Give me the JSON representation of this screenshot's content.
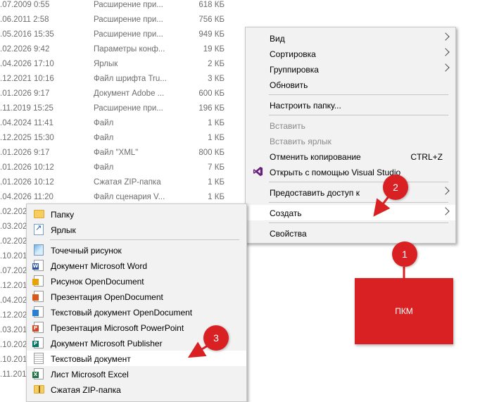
{
  "file_list": [
    {
      "date": ".07.2009 0:55",
      "type": "Расширение при...",
      "size": "618 КБ"
    },
    {
      "date": ".06.2011 2:58",
      "type": "Расширение при...",
      "size": "756 КБ"
    },
    {
      "date": ".05.2016 15:35",
      "type": "Расширение при...",
      "size": "949 КБ"
    },
    {
      "date": ".02.2026 9:42",
      "type": "Параметры конф...",
      "size": "19 КБ"
    },
    {
      "date": ".04.2026 17:10",
      "type": "Ярлык",
      "size": "2 КБ"
    },
    {
      "date": ".12.2021 10:16",
      "type": "Файл шрифта Tru...",
      "size": "3 КБ"
    },
    {
      "date": ".01.2026 9:17",
      "type": "Документ Adobe ...",
      "size": "600 КБ"
    },
    {
      "date": ".11.2019 15:25",
      "type": "Расширение при...",
      "size": "196 КБ"
    },
    {
      "date": ".04.2024 11:41",
      "type": "Файл",
      "size": "1 КБ"
    },
    {
      "date": ".12.2025 15:30",
      "type": "Файл",
      "size": "1 КБ"
    },
    {
      "date": ".01.2026 9:17",
      "type": "Файл \"XML\"",
      "size": "800 КБ"
    },
    {
      "date": ".01.2026 10:12",
      "type": "Файл",
      "size": "7 КБ"
    },
    {
      "date": ".01.2026 10:12",
      "type": "Сжатая ZIP-папка",
      "size": "1 КБ"
    },
    {
      "date": ".04.2026 11:20",
      "type": "Файл сценария V...",
      "size": "1 КБ"
    },
    {
      "date": ".02.2026",
      "type": "",
      "size": ""
    },
    {
      "date": ".03.202",
      "type": "",
      "size": ""
    },
    {
      "date": ".02.202",
      "type": "",
      "size": ""
    },
    {
      "date": ".10.201",
      "type": "",
      "size": ""
    },
    {
      "date": ".07.202",
      "type": "",
      "size": ""
    },
    {
      "date": ".12.201",
      "type": "",
      "size": ""
    },
    {
      "date": ".04.202",
      "type": "",
      "size": ""
    },
    {
      "date": ".12.202",
      "type": "",
      "size": ""
    },
    {
      "date": ".03.201",
      "type": "",
      "size": ""
    },
    {
      "date": ".10.202",
      "type": "",
      "size": ""
    },
    {
      "date": ".10.201",
      "type": "",
      "size": ""
    },
    {
      "date": ".11.201",
      "type": "",
      "size": ""
    }
  ],
  "context_menu": {
    "view": "Вид",
    "sort": "Сортировка",
    "group": "Группировка",
    "refresh": "Обновить",
    "customize": "Настроить папку...",
    "paste": "Вставить",
    "paste_shortcut": "Вставить ярлык",
    "undo_copy": "Отменить копирование",
    "undo_shortcut": "CTRL+Z",
    "open_vs": "Открыть с помощью Visual Studio",
    "share": "Предоставить доступ к",
    "create": "Создать",
    "properties": "Свойства"
  },
  "create_submenu": [
    {
      "label": "Папку",
      "icon": "folder-icon"
    },
    {
      "label": "Ярлык",
      "icon": "shortcut-icon"
    },
    {
      "label": "Точечный рисунок",
      "icon": "bitmap-icon"
    },
    {
      "label": "Документ Microsoft Word",
      "icon": "word-icon"
    },
    {
      "label": "Рисунок OpenDocument",
      "icon": "odg-icon"
    },
    {
      "label": "Презентация OpenDocument",
      "icon": "odp-icon"
    },
    {
      "label": "Текстовый документ OpenDocument",
      "icon": "odt-icon"
    },
    {
      "label": "Презентация Microsoft PowerPoint",
      "icon": "powerpoint-icon"
    },
    {
      "label": "Документ Microsoft Publisher",
      "icon": "publisher-icon"
    },
    {
      "label": "Текстовый документ",
      "icon": "text-document-icon"
    },
    {
      "label": "Лист Microsoft Excel",
      "icon": "excel-icon"
    },
    {
      "label": "Сжатая ZIP-папка",
      "icon": "zip-icon"
    }
  ],
  "annotations": {
    "step1": "1",
    "step2": "2",
    "step3": "3",
    "pkm_label": "ПКМ"
  },
  "colors": {
    "accent_red": "#d92124",
    "vs_purple": "#68217a",
    "word_blue": "#2b579a",
    "excel_green": "#217346",
    "ppt_orange": "#d24726",
    "publisher_teal": "#077568"
  }
}
